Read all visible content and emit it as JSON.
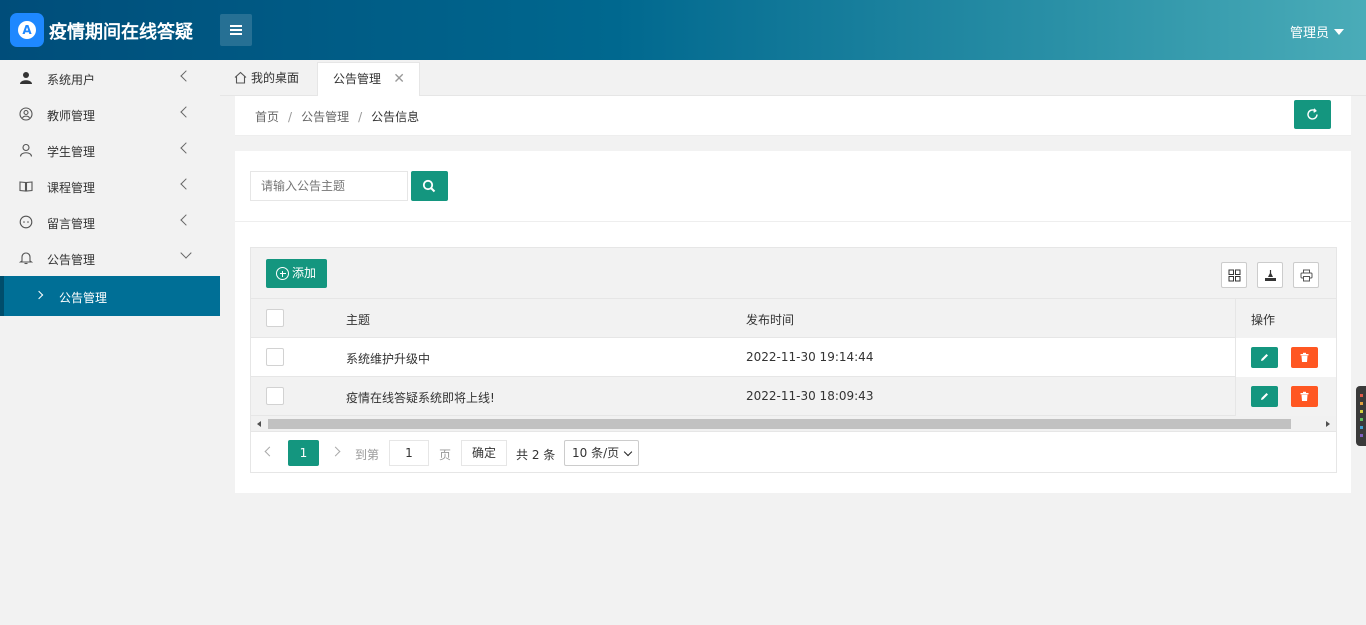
{
  "app": {
    "title": "疫情期间在线答疑",
    "logo_letter": "A"
  },
  "header": {
    "user_label": "管理员"
  },
  "sidebar": {
    "items": [
      {
        "label": "系统用户",
        "icon": "user-solid-icon"
      },
      {
        "label": "教师管理",
        "icon": "user-circle-icon"
      },
      {
        "label": "学生管理",
        "icon": "user-outline-icon"
      },
      {
        "label": "课程管理",
        "icon": "book-icon"
      },
      {
        "label": "留言管理",
        "icon": "chat-face-icon"
      },
      {
        "label": "公告管理",
        "icon": "bell-icon"
      }
    ],
    "active_sub": {
      "label": "公告管理"
    }
  },
  "tabs": [
    {
      "label": "我的桌面",
      "icon": "home-icon"
    },
    {
      "label": "公告管理",
      "closable": true,
      "close_glyph": "✕"
    }
  ],
  "breadcrumb": {
    "items": [
      "首页",
      "公告管理",
      "公告信息"
    ],
    "separator": "/"
  },
  "search": {
    "placeholder": "请输入公告主题",
    "value": ""
  },
  "toolbar": {
    "add_label": "添加"
  },
  "table": {
    "headers": {
      "subject": "主题",
      "time": "发布时间",
      "ops": "操作"
    },
    "rows": [
      {
        "subject": "系统维护升级中",
        "time": "2022-11-30 19:14:44"
      },
      {
        "subject": "疫情在线答疑系统即将上线!",
        "time": "2022-11-30 18:09:43"
      }
    ]
  },
  "pagination": {
    "current_page": "1",
    "goto_prefix": "到第",
    "goto_value": "1",
    "goto_suffix": "页",
    "confirm_label": "确定",
    "total_text": "共 2 条",
    "page_size": "10 条/页"
  },
  "colors": {
    "primary": "#14967f",
    "danger": "#ff5722",
    "sidebar_active": "#006f96"
  }
}
